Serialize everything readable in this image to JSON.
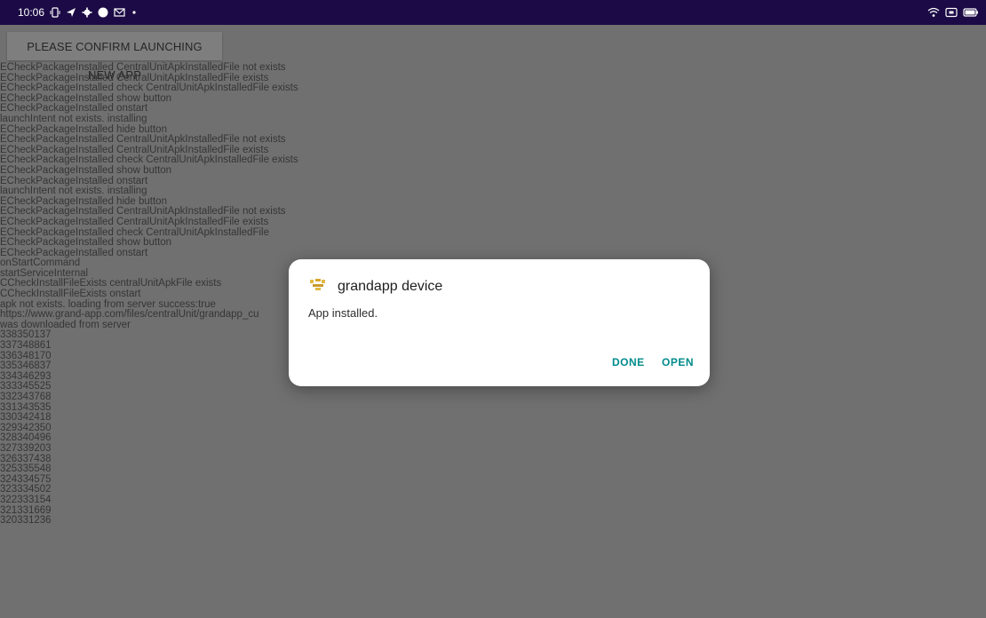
{
  "status_bar": {
    "time": "10:06",
    "left_icons": [
      "vibrate-icon",
      "navigation-icon",
      "settings-icon",
      "chat-icon",
      "mail-icon",
      "dot-icon"
    ],
    "right_icons": [
      "wifi-icon",
      "screen-icon",
      "battery-icon"
    ],
    "background": "#1b0a45"
  },
  "main": {
    "confirm_button_label": "PLEASE CONFIRM LAUNCHING NEW APP",
    "log_lines": [
      "ECheckPackageInstalled CentralUnitApkInstalledFile not exists",
      "ECheckPackageInstalled CentralUnitApkInstalledFile exists",
      "ECheckPackageInstalled check CentralUnitApkInstalledFile exists",
      "ECheckPackageInstalled show button",
      "ECheckPackageInstalled onstart",
      "launchIntent not exists. installing",
      "ECheckPackageInstalled hide button",
      "ECheckPackageInstalled CentralUnitApkInstalledFile not exists",
      "ECheckPackageInstalled CentralUnitApkInstalledFile exists",
      "ECheckPackageInstalled check CentralUnitApkInstalledFile exists",
      "ECheckPackageInstalled show button",
      "ECheckPackageInstalled onstart",
      "launchIntent not exists. installing",
      "ECheckPackageInstalled hide button",
      "ECheckPackageInstalled CentralUnitApkInstalledFile not exists",
      "ECheckPackageInstalled CentralUnitApkInstalledFile exists",
      "ECheckPackageInstalled check CentralUnitApkInstalledFile",
      "ECheckPackageInstalled show button",
      "ECheckPackageInstalled onstart",
      "onStartCommand",
      "startServiceInternal",
      "CCheckInstallFileExists centralUnitApkFile exists",
      "CCheckInstallFileExists onstart",
      "apk not exists. loading from server success:true",
      "https://www.grand-app.com/files/centralUnit/grandapp_cu",
      " was downloaded from server",
      "338350137",
      "337348861",
      "336348170",
      "335346837",
      "334346293",
      "333345525",
      "332343768",
      "331343535",
      "330342418",
      "329342350",
      "328340496",
      "327339203",
      "326337438",
      "325335548",
      "324334575",
      "323334502",
      "322333154",
      "321331669",
      "320331236"
    ]
  },
  "dialog": {
    "icon": "grandapp-logo-icon",
    "title": "grandapp device",
    "message": "App installed.",
    "done_label": "DONE",
    "open_label": "OPEN",
    "accent_color": "#008b8b"
  }
}
